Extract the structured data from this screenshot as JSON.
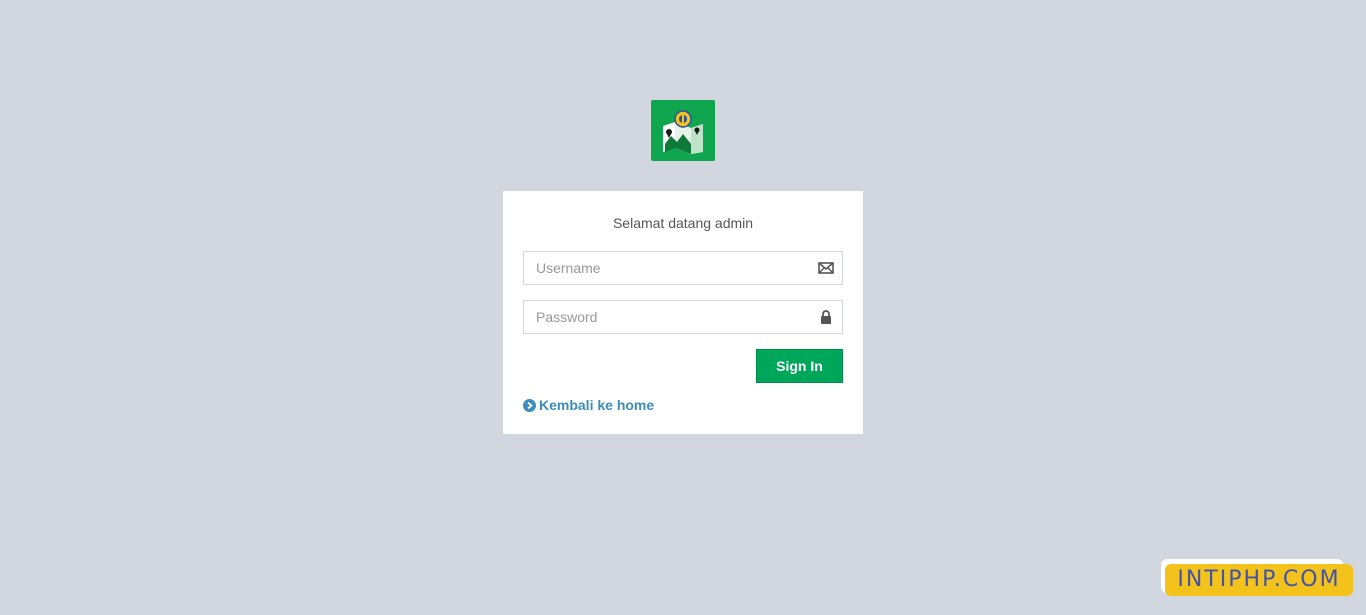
{
  "logo": {
    "icon": "map-emblem-icon",
    "bg_color": "#10a650"
  },
  "login": {
    "message": "Selamat datang admin",
    "username": {
      "value": "",
      "placeholder": "Username",
      "icon": "envelope-icon"
    },
    "password": {
      "value": "",
      "placeholder": "Password",
      "icon": "lock-icon"
    },
    "signin_label": "Sign In",
    "back_link_label": "Kembali ke home",
    "back_link_icon": "chevron-circle-right-icon"
  },
  "watermark": {
    "text": "INTIPHP.COM"
  },
  "colors": {
    "background": "#d2d6de",
    "primary": "#00a65a",
    "link": "#3c8dbc",
    "watermark_bg": "#f3c21b",
    "watermark_text": "#4353a8"
  }
}
